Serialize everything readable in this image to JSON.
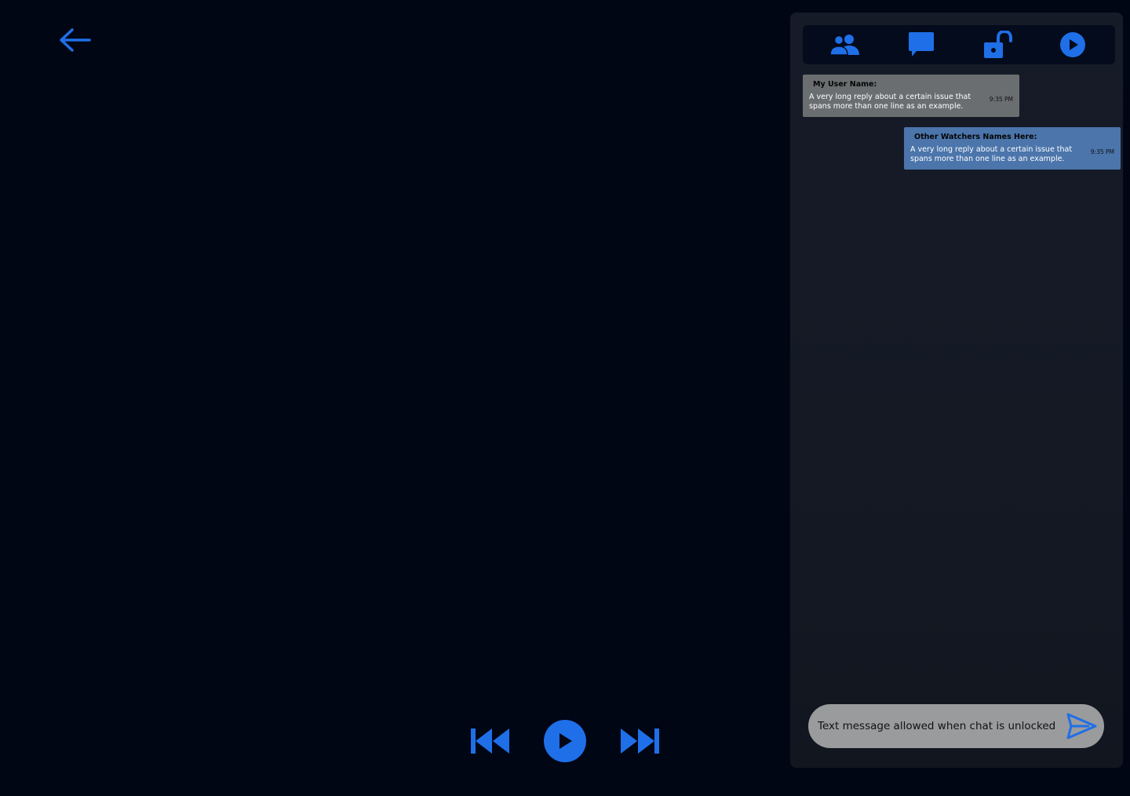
{
  "colors": {
    "background": "#010615",
    "accent": "#1f6fe8",
    "panel": "#151a26",
    "tabbar": "#030b1c",
    "my_message": "#6b6e70",
    "other_message": "#4b75ab",
    "composer": "#9a9b9d"
  },
  "nav": {
    "back_icon": "arrow-left-icon"
  },
  "player": {
    "prev_icon": "skip-previous-icon",
    "play_icon": "play-circle-icon",
    "next_icon": "skip-next-icon"
  },
  "panel": {
    "tabs": [
      {
        "icon": "people-icon"
      },
      {
        "icon": "chat-bubble-icon"
      },
      {
        "icon": "lock-open-icon"
      },
      {
        "icon": "play-circle-icon"
      }
    ],
    "messages": [
      {
        "sender": "My User Name:",
        "text": "A very long reply about a certain issue that spans more than one line as an example.",
        "time": "9:35 PM"
      },
      {
        "sender": "Other Watchers Names Here:",
        "text": "A very long reply about a certain issue that spans more than one line as an example.",
        "time": "9:35 PM"
      }
    ],
    "composer": {
      "placeholder": "Text message allowed when chat is unlocked",
      "value": "",
      "send_icon": "send-icon"
    }
  }
}
